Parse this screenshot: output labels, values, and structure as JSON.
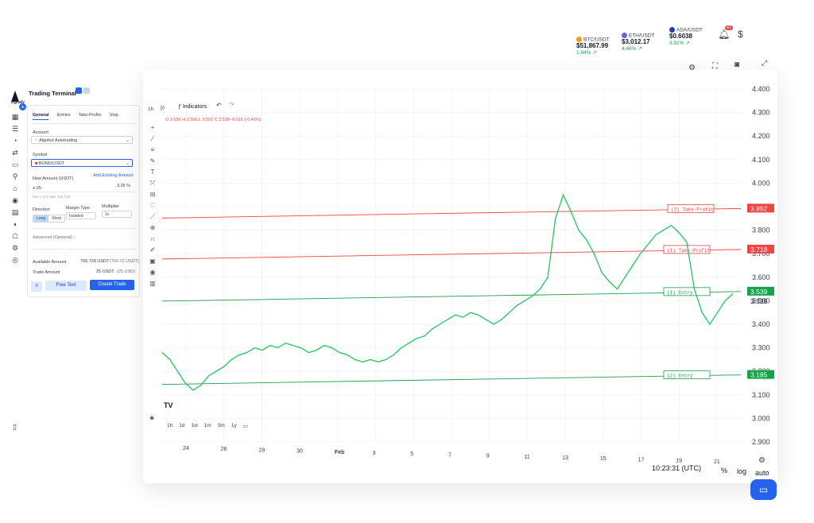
{
  "terminal": {
    "title": "Trading Terminal",
    "logo": "zignaly"
  },
  "tabs": [
    "General",
    "Entries",
    "Take-Profits",
    "Stop"
  ],
  "form": {
    "account_label": "Account",
    "account_value": "Algobot Autotrading",
    "symbol_label": "Symbol",
    "symbol_value": "BOND/USDT",
    "new_amount_label": "New Amount (USDT)",
    "add_existing": "Add Existing Amount",
    "amount_value": "25",
    "amount_percent": "3.26 %",
    "minmax": "Min 1.172 Max 765.728",
    "direction_label": "Direction",
    "margin_label": "Margin Type",
    "multiplier_label": "Multiplier",
    "long": "Long",
    "short": "Short",
    "margin_value": "Isolated",
    "multiplier_value": "1x",
    "advanced": "Advanced (Optional)",
    "available_label": "Available Amount",
    "available_value": "765.728 USDT",
    "available_sub": "(765.72 USDT)",
    "trade_label": "Trade Amount",
    "trade_value": "25 USDT",
    "trade_sub": "(25 USD)",
    "free_text": "Free Text",
    "create_trade": "Create Trade"
  },
  "tickers": [
    {
      "name": "BTC/USDT",
      "price": "$51,867.99",
      "change": "1.84% ↗",
      "color": "#f59e0b"
    },
    {
      "name": "ETH/USDT",
      "price": "$3,012.17",
      "change": "4.46% ↗",
      "color": "#6366f1"
    },
    {
      "name": "ADA/USDT",
      "price": "$0.6038",
      "change": "3.92% ↗",
      "color": "#1e40af"
    }
  ],
  "notifications_badge": "41",
  "chart_toolbar": {
    "interval": "1h",
    "indicators": "Indicators"
  },
  "ohlc": {
    "o": "O 3.556",
    "h": "H 3.556",
    "l": "L 3.522",
    "c": "C 3.528",
    "chg": "-0.016 (-0.45%)"
  },
  "timeframes": [
    "1h",
    "1d",
    "1w",
    "1m",
    "3m",
    "1y"
  ],
  "clock": "10:23:31 (UTC)",
  "scale_percent": "%",
  "scale_log": "log",
  "scale_auto": "auto",
  "chart_data": {
    "type": "line",
    "x_ticks": [
      "24",
      "26",
      "28",
      "30",
      "Feb",
      "3",
      "5",
      "7",
      "9",
      "11",
      "13",
      "15",
      "17",
      "19",
      "21"
    ],
    "y_ticks": [
      "4.400",
      "4.300",
      "4.200",
      "4.100",
      "4.000",
      "3.900",
      "3.800",
      "3.700",
      "3.600",
      "3.500",
      "3.400",
      "3.300",
      "3.200",
      "3.100",
      "3.000",
      "2.900"
    ],
    "ylim": [
      2.9,
      4.4
    ],
    "price_labels": [
      {
        "text": "3.892",
        "value": 3.892,
        "color": "#ef4444"
      },
      {
        "text": "3.718",
        "value": 3.718,
        "color": "#ef4444"
      },
      {
        "text": "3.539",
        "value": 3.539,
        "color": "#16a34a"
      },
      {
        "text": "3.539",
        "value": 3.539,
        "color": "#111827",
        "plain": true
      },
      {
        "text": "3.185",
        "value": 3.185,
        "color": "#16a34a"
      }
    ],
    "order_lines": [
      {
        "label": "(2) Take-Profit",
        "value": 3.892,
        "color": "#ef4444"
      },
      {
        "label": "(1) Take-Profit",
        "value": 3.718,
        "color": "#ef4444"
      },
      {
        "label": "(1) Entry",
        "value": 3.539,
        "color": "#16a34a"
      },
      {
        "label": "(2) Entry",
        "value": 3.185,
        "color": "#16a34a"
      }
    ],
    "price_series": [
      3.28,
      3.25,
      3.2,
      3.15,
      3.12,
      3.14,
      3.18,
      3.2,
      3.22,
      3.25,
      3.27,
      3.28,
      3.3,
      3.29,
      3.31,
      3.3,
      3.32,
      3.31,
      3.3,
      3.28,
      3.29,
      3.31,
      3.3,
      3.28,
      3.27,
      3.25,
      3.24,
      3.25,
      3.24,
      3.25,
      3.27,
      3.3,
      3.32,
      3.34,
      3.35,
      3.38,
      3.4,
      3.42,
      3.44,
      3.43,
      3.45,
      3.44,
      3.42,
      3.4,
      3.42,
      3.45,
      3.48,
      3.5,
      3.52,
      3.55,
      3.6,
      3.85,
      3.95,
      3.88,
      3.8,
      3.76,
      3.7,
      3.62,
      3.58,
      3.55,
      3.6,
      3.65,
      3.7,
      3.74,
      3.78,
      3.8,
      3.82,
      3.79,
      3.75,
      3.55,
      3.45,
      3.4,
      3.45,
      3.5,
      3.53
    ]
  }
}
